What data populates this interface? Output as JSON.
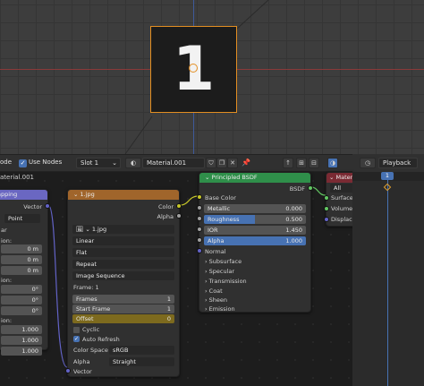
{
  "header": {
    "mode_label": "ode",
    "use_nodes": "Use Nodes",
    "slot": "Slot 1",
    "material_name": "Material.001",
    "playback": "Playback"
  },
  "viewport": {
    "plane_text": "1"
  },
  "nodes": {
    "mapping": {
      "title": "apping",
      "material_label": "aterial.001",
      "vector_out": "Vector",
      "type": "Point",
      "rows": [
        "ar",
        "ion:",
        "ion:",
        "ion:"
      ],
      "loc_values": [
        "0 m",
        "0 m",
        "0 m"
      ],
      "rot_values": [
        "0°",
        "0°",
        "0°"
      ],
      "scale_values": [
        "1.000",
        "1.000",
        "1.000"
      ]
    },
    "image": {
      "title": "1.jpg",
      "color_out": "Color",
      "alpha_out": "Alpha",
      "image_name": "1.jpg",
      "interpolation": "Linear",
      "projection": "Flat",
      "extension": "Repeat",
      "source": "Image Sequence",
      "frame": "Frame: 1",
      "frames_label": "Frames",
      "frames_value": "1",
      "start_label": "Start Frame",
      "start_value": "1",
      "offset_label": "Offset",
      "offset_value": "0",
      "cyclic": "Cyclic",
      "auto_refresh": "Auto Refresh",
      "color_space_label": "Color Space",
      "color_space": "sRGB",
      "alpha_label": "Alpha",
      "alpha_mode": "Straight",
      "vector_in": "Vector"
    },
    "bsdf": {
      "title": "Principled BSDF",
      "bsdf_out": "BSDF",
      "base_color": "Base Color",
      "metallic_label": "Metallic",
      "metallic": "0.000",
      "roughness_label": "Roughness",
      "roughness": "0.500",
      "ior_label": "IOR",
      "ior": "1.450",
      "alpha_label": "Alpha",
      "alpha": "1.000",
      "normal": "Normal",
      "sections": [
        "Subsurface",
        "Specular",
        "Transmission",
        "Coat",
        "Sheen",
        "Emission"
      ]
    },
    "output": {
      "title": "Materi",
      "target": "All",
      "surface": "Surface",
      "volume": "Volume",
      "displacement": "Displacer"
    }
  },
  "timeline": {
    "frame": "1"
  }
}
